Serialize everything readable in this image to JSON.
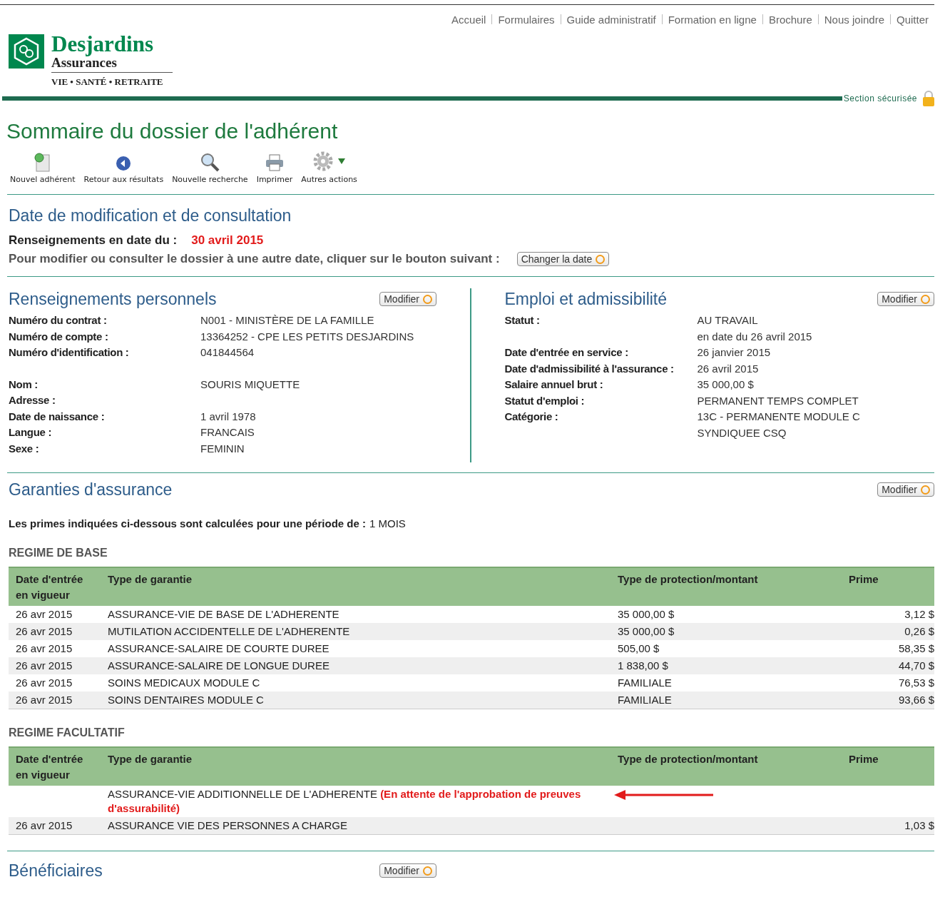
{
  "top_nav": [
    "Accueil",
    "Formulaires",
    "Guide administratif",
    "Formation en ligne",
    "Brochure",
    "Nous joindre",
    "Quitter"
  ],
  "logo": {
    "name": "Desjardins",
    "sub": "Assurances",
    "tagline": "VIE • SANTÉ • RETRAITE"
  },
  "secure_label": "Section sécurisée",
  "page_title": "Sommaire du dossier de l'adhérent",
  "toolbar": [
    {
      "kind": "new",
      "label": "Nouvel adhérent"
    },
    {
      "kind": "back",
      "label": "Retour aux résultats"
    },
    {
      "kind": "search",
      "label": "Nouvelle recherche"
    },
    {
      "kind": "print",
      "label": "Imprimer"
    },
    {
      "kind": "more",
      "label": "Autres actions"
    }
  ],
  "date_section": {
    "title": "Date de modification et de consultation",
    "label": "Renseignements en date du :",
    "date": "30 avril 2015",
    "instruction": "Pour modifier ou consulter le dossier à une autre date, cliquer sur le bouton suivant :",
    "button": "Changer la date"
  },
  "personal": {
    "title": "Renseignements personnels",
    "button": "Modifier",
    "fields": [
      {
        "label": "Numéro du contrat :",
        "value": "N001 -  MINISTÈRE DE LA FAMILLE"
      },
      {
        "label": "Numéro de compte :",
        "value": "13364252 - CPE LES PETITS DESJARDINS"
      },
      {
        "label": "Numéro d'identification :",
        "value": "041844564",
        "gap_after": true
      },
      {
        "label": "Nom :",
        "value": "SOURIS MIQUETTE"
      },
      {
        "label": "Adresse :"
      },
      {
        "label": "Date de naissance :",
        "value": "1 avril 1978"
      },
      {
        "label": "Langue :",
        "value": "FRANCAIS"
      },
      {
        "label": "Sexe :",
        "value": "FEMININ"
      }
    ]
  },
  "employment": {
    "title": "Emploi et admissibilité",
    "button": "Modifier",
    "fields": [
      {
        "label": "Statut :",
        "value": "AU TRAVAIL",
        "value_2": "en date du 26 avril 2015"
      },
      {
        "label": "Date d'entrée en service :",
        "value": "26 janvier 2015"
      },
      {
        "label": "Date d'admissibilité à l'assurance :",
        "value": "26 avril 2015"
      },
      {
        "label": "Salaire annuel brut :",
        "value": "35 000,00 $"
      },
      {
        "label": "Statut d'emploi :",
        "value": "PERMANENT TEMPS COMPLET"
      },
      {
        "label": "Catégorie :",
        "value": "13C - PERMANENTE MODULE C",
        "value_2": "SYNDIQUEE CSQ"
      }
    ]
  },
  "coverage": {
    "title": "Garanties d'assurance",
    "button": "Modifier",
    "period_label": "Les primes indiquées ci-dessous sont calculées pour une période de :",
    "period_value": "1 MOIS",
    "tables": [
      {
        "title": "REGIME DE BASE",
        "columns": [
          "Date d'entrée en vigueur",
          "Type de garantie",
          "Type de protection/montant",
          "Prime"
        ],
        "rows": [
          {
            "date": "26 avr 2015",
            "type": "ASSURANCE-VIE DE BASE DE L'ADHERENTE",
            "protection": "35 000,00 $",
            "premium": "3,12 $"
          },
          {
            "date": "26 avr 2015",
            "type": "MUTILATION ACCIDENTELLE DE L'ADHERENTE",
            "protection": "35 000,00 $",
            "premium": "0,26 $"
          },
          {
            "date": "26 avr 2015",
            "type": "ASSURANCE-SALAIRE DE COURTE DUREE",
            "protection": "505,00 $",
            "premium": "58,35 $"
          },
          {
            "date": "26 avr 2015",
            "type": "ASSURANCE-SALAIRE DE LONGUE DUREE",
            "protection": "1 838,00 $",
            "premium": "44,70 $"
          },
          {
            "date": "26 avr 2015",
            "type": "SOINS MEDICAUX MODULE C",
            "protection": "FAMILIALE",
            "premium": "76,53 $"
          },
          {
            "date": "26 avr 2015",
            "type": "SOINS DENTAIRES MODULE C",
            "protection": "FAMILIALE",
            "premium": "93,66 $"
          }
        ]
      },
      {
        "title": "REGIME FACULTATIF",
        "columns": [
          "Date d'entrée en vigueur",
          "Type de garantie",
          "Type de protection/montant",
          "Prime"
        ],
        "rows": [
          {
            "type": "ASSURANCE-VIE ADDITIONNELLE DE L'ADHERENTE",
            "note": "(En attente de l'approbation de preuves d'assurabilité)",
            "flagged": true
          },
          {
            "date": "26 avr 2015",
            "type": "ASSURANCE VIE DES PERSONNES A CHARGE",
            "premium": "1,03 $",
            "flagged": false
          }
        ]
      }
    ]
  },
  "beneficiaries": {
    "title": "Bénéficiaires",
    "button": "Modifier"
  }
}
